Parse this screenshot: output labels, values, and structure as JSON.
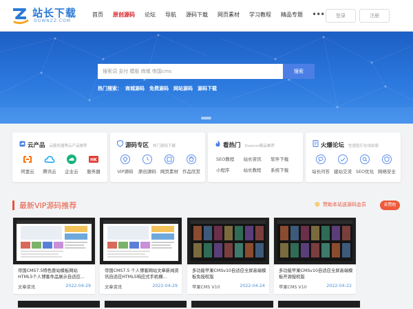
{
  "logo": {
    "cn": "站长下载",
    "en": "DOWNZZ.COM",
    "color": "#2a7ad6"
  },
  "nav": [
    {
      "label": "首页",
      "active": false
    },
    {
      "label": "原创源码",
      "active": true
    },
    {
      "label": "论坛",
      "active": false
    },
    {
      "label": "导航",
      "active": false
    },
    {
      "label": "源码下载",
      "active": false
    },
    {
      "label": "网页素材",
      "active": false
    },
    {
      "label": "学习教程",
      "active": false
    },
    {
      "label": "精品专题",
      "active": false
    }
  ],
  "nav_more": "•••",
  "auth": {
    "login": "登录",
    "register": "注册"
  },
  "search": {
    "placeholder": "搜索词 支付 模板 商城 帝国cms",
    "button": "搜索",
    "hot_label": "热门搜索：",
    "hot_links": [
      "商城源码",
      "免费源码",
      "网站源码",
      "源码下载"
    ]
  },
  "cards": [
    {
      "title": "云产品",
      "subtitle": "云服务器等云产品推荐",
      "icon": "cloud-icon",
      "items": [
        {
          "label": "阿里云",
          "icon": "aliyun-icon",
          "color": "#ff6a00"
        },
        {
          "label": "腾讯云",
          "icon": "tencent-cloud-icon",
          "color": "#00a3ff"
        },
        {
          "label": "企业云",
          "icon": "enterprise-cloud-icon",
          "color": "#19b37b"
        },
        {
          "label": "服务器",
          "icon": "server-icon",
          "color": "#e03c31"
        }
      ]
    },
    {
      "title": "源码专区",
      "subtitle": "热门源码下载",
      "icon": "shield-icon",
      "items": [
        {
          "label": "VIP源码",
          "icon": "vip-icon",
          "color": "#5b8def"
        },
        {
          "label": "原创源码",
          "icon": "original-icon",
          "color": "#5b8def"
        },
        {
          "label": "网页素材",
          "icon": "material-icon",
          "color": "#5b8def"
        },
        {
          "label": "作品欣赏",
          "icon": "works-icon",
          "color": "#5b8def"
        }
      ]
    },
    {
      "title": "看热门",
      "subtitle": "Downzz精品推荐",
      "icon": "fire-icon",
      "links": [
        "SEO教程",
        "站长资讯",
        "软件下载",
        "小程序",
        "站长教程",
        "系统下载"
      ]
    },
    {
      "title": "火爆论坛",
      "subtitle": "性感医疗在线原版",
      "icon": "forum-icon",
      "items": [
        {
          "label": "站长问答",
          "icon": "qa-icon",
          "color": "#5b8def"
        },
        {
          "label": "建站交流",
          "icon": "exchange-icon",
          "color": "#5b8def"
        },
        {
          "label": "SEO优化",
          "icon": "seo-icon",
          "color": "#5b8def"
        },
        {
          "label": "网络安全",
          "icon": "security-icon",
          "color": "#5b8def"
        }
      ]
    }
  ],
  "vip": {
    "title": "最新VIP源码推荐",
    "sponsor_text": "赞助本站送源码会员",
    "sponsor_button": "去赞助",
    "accent": "#e8533a",
    "items": [
      {
        "title": "帝国CMS7.5特色兽站模板网站HTML5个人博客件品展示自适应...",
        "category": "文章资讯",
        "date": "2022-04-29"
      },
      {
        "title": "帝国CMS7.5 个人博客网站文章新闻资讯自适应HTML5响应式手机横...",
        "category": "文章资讯",
        "date": "2022-04-29"
      },
      {
        "title": "多功能苹果CMSv10自适应全屏高端模板免授权版",
        "category": "苹果CMS V10",
        "date": "2022-04-24"
      },
      {
        "title": "多功能苹果CMSv10自适应全屏高端模板开源授权版",
        "category": "苹果CMS V10",
        "date": "2022-04-22"
      }
    ]
  }
}
